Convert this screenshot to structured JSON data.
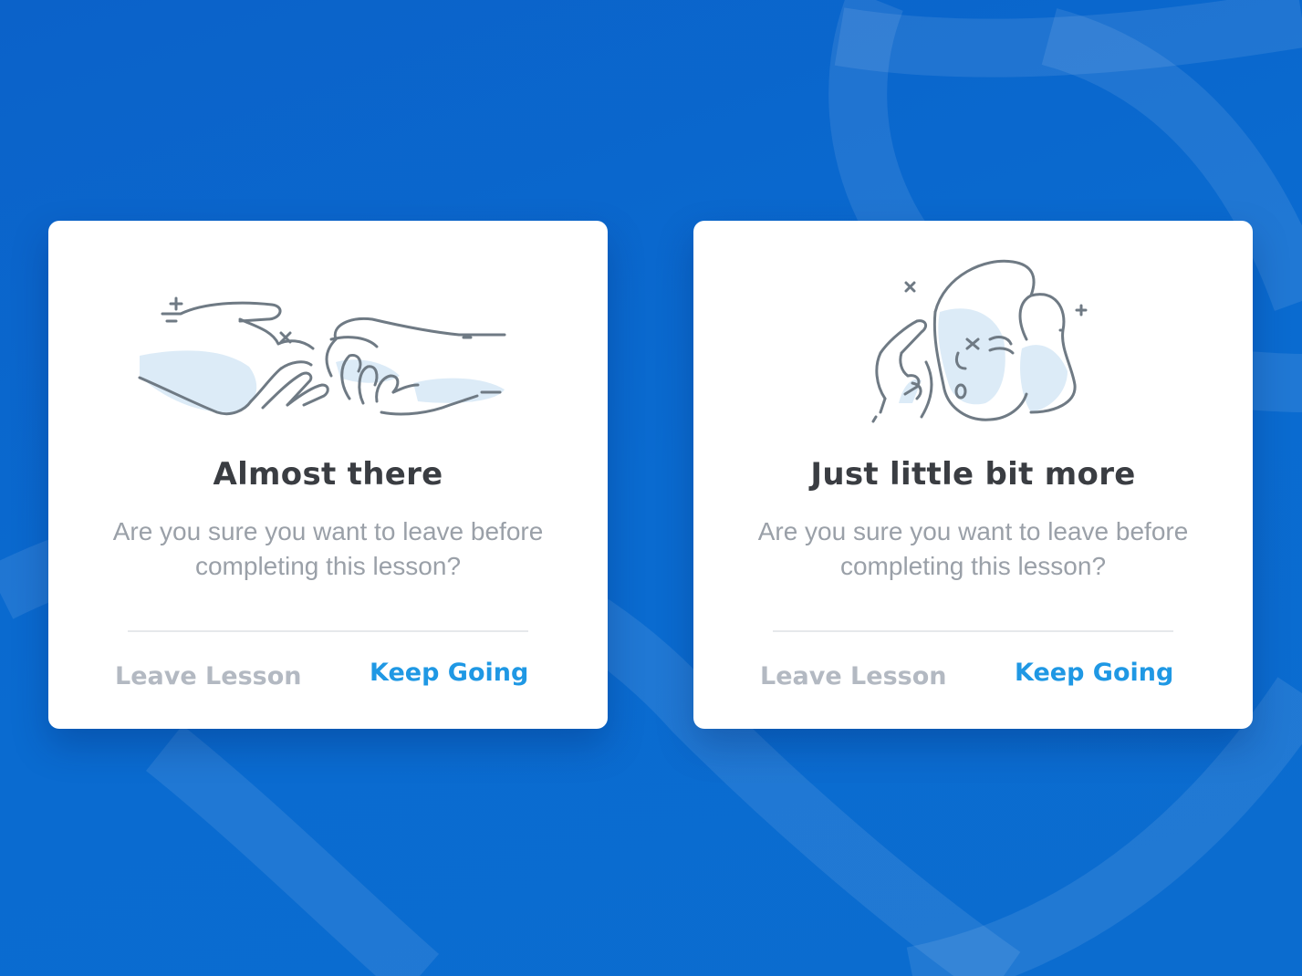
{
  "background": {
    "color": "#0b68cf"
  },
  "dialogs": [
    {
      "illustration": "reaching-hands-icon",
      "title": "Almost there",
      "message": "Are you sure you want to leave before completing this lesson?",
      "leave_label": "Leave Lesson",
      "keep_label": "Keep Going"
    },
    {
      "illustration": "thinking-face-icon",
      "title": "Just little bit more",
      "message": "Are you sure you want to leave before completing this lesson?",
      "leave_label": "Leave Lesson",
      "keep_label": "Keep Going"
    }
  ],
  "colors": {
    "title": "#3a3d42",
    "message": "#9aa0a8",
    "leave_button": "#b3b9c2",
    "keep_button": "#1f98e4",
    "illustration_stroke": "#6f7a84",
    "illustration_fill": "#dcebf7"
  }
}
